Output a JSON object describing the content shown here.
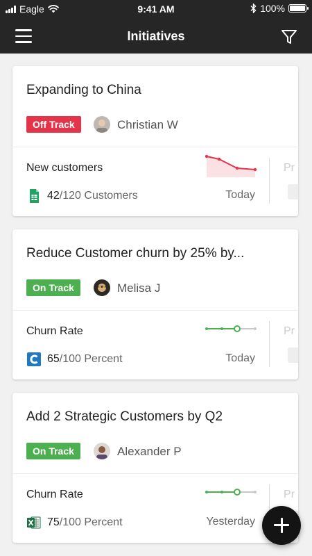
{
  "status_bar": {
    "carrier": "Eagle",
    "time": "9:41 AM",
    "battery": "100%"
  },
  "navbar": {
    "title": "Initiatives",
    "menu_icon": "hamburger-menu-icon",
    "filter_icon": "filter-funnel-icon"
  },
  "colors": {
    "off_track": "#e3344a",
    "on_track": "#4caf50",
    "header": "#262626",
    "spark_red": "#e3344a",
    "spark_green": "#4caf50"
  },
  "cards": [
    {
      "title": "Expanding to China",
      "status": "Off Track",
      "owner": "Christian W",
      "metric_name": "New customers",
      "value": "42",
      "total": "/120 Customers",
      "date": "Today",
      "source_icon": "google-sheets-icon",
      "peek_label": "Pr",
      "trend": "declining",
      "sparkline": [
        0.9,
        0.75,
        0.32,
        0.25
      ]
    },
    {
      "title": "Reduce Customer churn by 25% by...",
      "status": "On Track",
      "owner": "Melisa J",
      "metric_name": "Churn Rate",
      "value": "65",
      "total": "/100 Percent",
      "date": "Today",
      "source_icon": "confluence-c-icon",
      "peek_label": "Pr",
      "trend": "progress"
    },
    {
      "title": "Add 2 Strategic Customers by Q2",
      "status": "On Track",
      "owner": "Alexander P",
      "metric_name": "Churn Rate",
      "value": "75",
      "total": "/100 Percent",
      "date": "Yesterday",
      "source_icon": "excel-icon",
      "peek_label": "Pr",
      "trend": "progress"
    }
  ],
  "fab": {
    "icon": "plus-icon"
  }
}
